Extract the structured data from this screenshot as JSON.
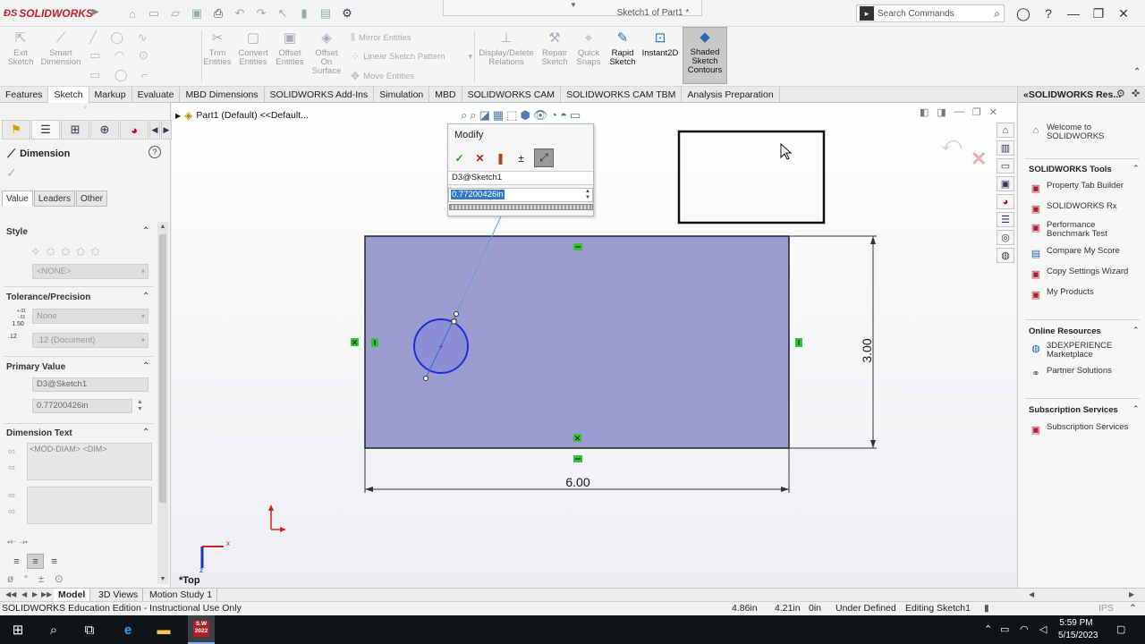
{
  "window": {
    "app_name": "SOLIDWORKS",
    "doc_title": "Sketch1 of Part1 *",
    "search_placeholder": "Search Commands"
  },
  "commands": {
    "exit_sketch": "Exit Sketch",
    "smart_dimension": "Smart Dimension",
    "trim_entities": "Trim Entities",
    "convert_entities": "Convert Entities",
    "offset_entities": "Offset Entities",
    "offset_on_surface": "Offset On Surface",
    "mirror_entities": "Mirror Entities",
    "linear_sketch_pattern": "Linear Sketch Pattern",
    "move_entities": "Move Entities",
    "display_delete_relations": "Display/Delete Relations",
    "repair_sketch": "Repair Sketch",
    "quick_snaps": "Quick Snaps",
    "rapid_sketch": "Rapid Sketch",
    "instant2d": "Instant2D",
    "shaded_sketch_contours": "Shaded Sketch Contours"
  },
  "tabs": [
    "Features",
    "Sketch",
    "Markup",
    "Evaluate",
    "MBD Dimensions",
    "SOLIDWORKS Add-Ins",
    "Simulation",
    "MBD",
    "SOLIDWORKS CAM",
    "SOLIDWORKS CAM TBM",
    "Analysis Preparation"
  ],
  "property_manager": {
    "title": "Dimension",
    "tabs": [
      "Value",
      "Leaders",
      "Other"
    ],
    "style_header": "Style",
    "style_value": "<NONE>",
    "tolerance_header": "Tolerance/Precision",
    "tolerance_value": "None",
    "tol_icon_top": "1.50",
    "tol_icon_sub": "+.01 -.01",
    "prec_icon": ".12",
    "precision_value": ".12 (Document)",
    "primary_header": "Primary Value",
    "primary_name": "D3@Sketch1",
    "primary_value": "0.77200426in",
    "dimtext_header": "Dimension Text",
    "dimtext_value": "<MOD-DIAM> <DIM>"
  },
  "graphics": {
    "tree_item": "Part1 (Default) <<Default...",
    "view_label": "*Top",
    "triad_x": "x",
    "triad_z": "z",
    "dim_width": "6.00",
    "dim_height": "3.00"
  },
  "modify": {
    "title": "Modify",
    "dim_name": "D3@Sketch1",
    "value": "0.77200426in"
  },
  "task_pane": {
    "header": "SOLIDWORKS Res...",
    "welcome": "Welcome to SOLIDWORKS",
    "tools_header": "SOLIDWORKS Tools",
    "tools": [
      "Property Tab Builder",
      "SOLIDWORKS Rx",
      "Performance Benchmark Test",
      "Compare My Score",
      "Copy Settings Wizard",
      "My Products"
    ],
    "online_header": "Online Resources",
    "online": [
      "3DEXPERIENCE Marketplace",
      "Partner Solutions"
    ],
    "subscription_header": "Subscription Services",
    "subscription": [
      "Subscription Services"
    ]
  },
  "bottom_tabs": [
    "Model",
    "3D Views",
    "Motion Study 1"
  ],
  "status": {
    "edition": "SOLIDWORKS Education Edition - Instructional Use Only",
    "x": "4.86in",
    "y": "4.21in",
    "z": "0in",
    "state": "Under Defined",
    "mode": "Editing Sketch1",
    "units": "IPS"
  },
  "taskbar": {
    "sw_badge": "S.W 2022",
    "time": "5:59 PM",
    "date": "5/15/2023"
  },
  "colors": {
    "sketch_fill": "#9c9cd0",
    "circle": "#1f2ed6",
    "accent": "#c0202a"
  }
}
